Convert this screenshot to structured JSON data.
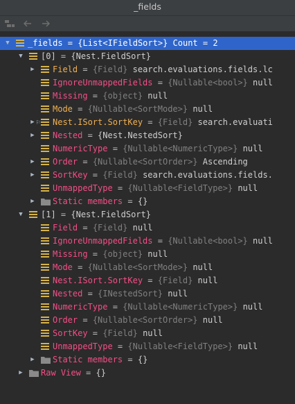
{
  "window": {
    "title": "_fields"
  },
  "toolbar": {
    "icons": [
      "collapse-icon",
      "back-icon",
      "forward-icon"
    ]
  },
  "rows": [
    {
      "indent": 0,
      "arrow": "down",
      "icon": "field",
      "name": "_fields",
      "eq": " = ",
      "type": "",
      "value": "{List<IFieldSort>} Count = 2",
      "nameStyle": "plain",
      "selected": true
    },
    {
      "indent": 1,
      "arrow": "down",
      "icon": "field",
      "name": "[0]",
      "eq": " = ",
      "type": "",
      "value": "{Nest.FieldSort}",
      "nameStyle": "plain"
    },
    {
      "indent": 2,
      "arrow": "right",
      "icon": "field",
      "name": "Field",
      "eq": " = ",
      "type": "{Field}",
      "value": " search.evaluations.fields.lc"
    },
    {
      "indent": 2,
      "arrow": "",
      "icon": "field",
      "name": "IgnoreUnmappedFields",
      "eq": " = ",
      "type": "{Nullable<bool>}",
      "value": " null",
      "nameStyle": "pink"
    },
    {
      "indent": 2,
      "arrow": "",
      "icon": "field",
      "name": "Missing",
      "eq": " = ",
      "type": "{object}",
      "value": " null",
      "nameStyle": "pink"
    },
    {
      "indent": 2,
      "arrow": "",
      "icon": "field",
      "name": "Mode",
      "eq": " = ",
      "type": "{Nullable<SortMode>}",
      "value": " null"
    },
    {
      "indent": 2,
      "arrow": "right",
      "icon": "field",
      "flag": true,
      "name": "Nest.ISort.SortKey",
      "eq": " = ",
      "type": "{Field}",
      "value": " search.evaluati"
    },
    {
      "indent": 2,
      "arrow": "right",
      "icon": "field",
      "name": "Nested",
      "eq": " = ",
      "type": "",
      "value": "{Nest.NestedSort}",
      "nameStyle": "pink"
    },
    {
      "indent": 2,
      "arrow": "",
      "icon": "field",
      "name": "NumericType",
      "eq": " = ",
      "type": "{Nullable<NumericType>}",
      "value": " null",
      "nameStyle": "pink"
    },
    {
      "indent": 2,
      "arrow": "right",
      "icon": "field",
      "name": "Order",
      "eq": " = ",
      "type": "{Nullable<SortOrder>}",
      "value": " Ascending",
      "nameStyle": "pink"
    },
    {
      "indent": 2,
      "arrow": "right",
      "icon": "field",
      "name": "SortKey",
      "eq": " = ",
      "type": "{Field}",
      "value": " search.evaluations.fields.",
      "nameStyle": "pink"
    },
    {
      "indent": 2,
      "arrow": "",
      "icon": "field",
      "name": "UnmappedType",
      "eq": " = ",
      "type": "{Nullable<FieldType>}",
      "value": " null",
      "nameStyle": "pink"
    },
    {
      "indent": 2,
      "arrow": "right",
      "icon": "folder",
      "name": "Static members",
      "eq": " = ",
      "type": "",
      "value": "{}",
      "nameStyle": "pink"
    },
    {
      "indent": 1,
      "arrow": "down",
      "icon": "field",
      "name": "[1]",
      "eq": " = ",
      "type": "",
      "value": "{Nest.FieldSort}",
      "nameStyle": "plain"
    },
    {
      "indent": 2,
      "arrow": "",
      "icon": "field",
      "name": "Field",
      "eq": " = ",
      "type": "{Field}",
      "value": " null",
      "nameStyle": "pink"
    },
    {
      "indent": 2,
      "arrow": "",
      "icon": "field",
      "name": "IgnoreUnmappedFields",
      "eq": " = ",
      "type": "{Nullable<bool>}",
      "value": " null",
      "nameStyle": "pink"
    },
    {
      "indent": 2,
      "arrow": "",
      "icon": "field",
      "name": "Missing",
      "eq": " = ",
      "type": "{object}",
      "value": " null",
      "nameStyle": "pink"
    },
    {
      "indent": 2,
      "arrow": "",
      "icon": "field",
      "name": "Mode",
      "eq": " = ",
      "type": "{Nullable<SortMode>}",
      "value": " null",
      "nameStyle": "pink"
    },
    {
      "indent": 2,
      "arrow": "",
      "icon": "field",
      "name": "Nest.ISort.SortKey",
      "eq": " = ",
      "type": "{Field}",
      "value": " null",
      "nameStyle": "pink"
    },
    {
      "indent": 2,
      "arrow": "",
      "icon": "field",
      "name": "Nested",
      "eq": " = ",
      "type": "{INestedSort}",
      "value": " null",
      "nameStyle": "pink"
    },
    {
      "indent": 2,
      "arrow": "",
      "icon": "field",
      "name": "NumericType",
      "eq": " = ",
      "type": "{Nullable<NumericType>}",
      "value": " null",
      "nameStyle": "pink"
    },
    {
      "indent": 2,
      "arrow": "",
      "icon": "field",
      "name": "Order",
      "eq": " = ",
      "type": "{Nullable<SortOrder>}",
      "value": " null",
      "nameStyle": "pink"
    },
    {
      "indent": 2,
      "arrow": "",
      "icon": "field",
      "name": "SortKey",
      "eq": " = ",
      "type": "{Field}",
      "value": " null",
      "nameStyle": "pink"
    },
    {
      "indent": 2,
      "arrow": "",
      "icon": "field",
      "name": "UnmappedType",
      "eq": " = ",
      "type": "{Nullable<FieldType>}",
      "value": " null",
      "nameStyle": "pink"
    },
    {
      "indent": 2,
      "arrow": "right",
      "icon": "folder",
      "name": "Static members",
      "eq": " = ",
      "type": "",
      "value": "{}",
      "nameStyle": "pink"
    },
    {
      "indent": 1,
      "arrow": "right",
      "icon": "folder",
      "name": "Raw View",
      "eq": " = ",
      "type": "",
      "value": "{}",
      "nameStyle": "pink"
    }
  ]
}
